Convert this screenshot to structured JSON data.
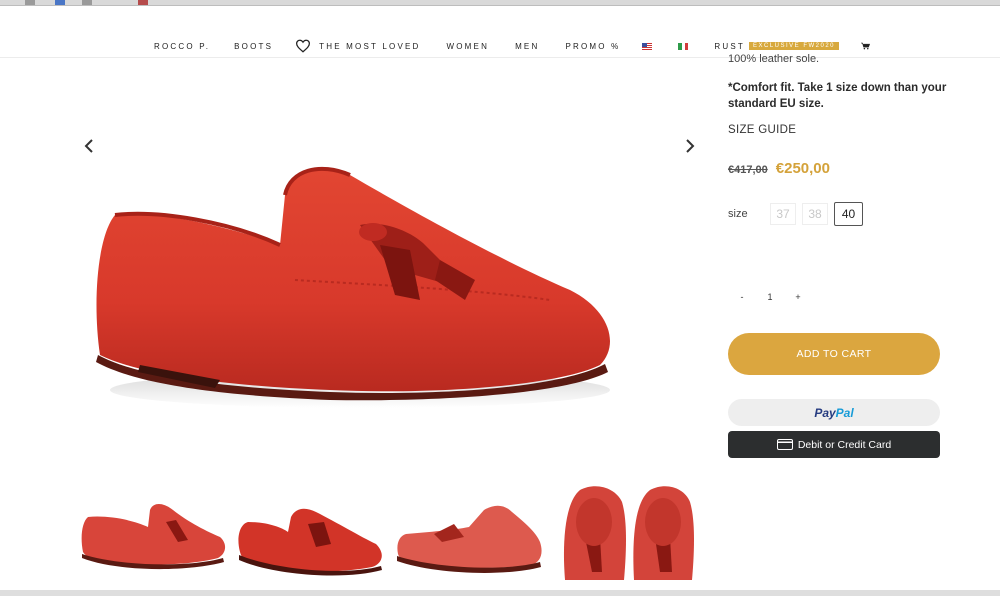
{
  "nav": {
    "items": [
      "ROCCO P.",
      "BOOTS",
      "THE MOST LOVED",
      "WOMEN",
      "MEN",
      "PROMO %"
    ],
    "rust_label": "RUST",
    "rust_badge": "EXCLUSIVE FW2020",
    "icons": [
      "heart-icon",
      "flag-us-icon",
      "flag-it-icon",
      "cart-icon"
    ]
  },
  "gallery": {
    "prev_icon": "chevron-left-icon",
    "next_icon": "chevron-right-icon",
    "main_image": "red suede tassel loafer",
    "thumbnails": [
      "red loafer side view",
      "red loafer angled view",
      "red loafer inner side view",
      "red loafers top view pair"
    ]
  },
  "product": {
    "description_partial": "100% leather sole.",
    "comfort_note": "*Comfort fit. Take 1 size down than your standard EU size.",
    "size_guide": "SIZE GUIDE",
    "price_old": "€417,00",
    "price_new": "€250,00",
    "size_label": "size",
    "sizes": [
      "37",
      "38",
      "40"
    ],
    "selected_size": "40",
    "qty_minus": "-",
    "qty_value": "1",
    "qty_plus": "+",
    "add_to_cart": "ADD TO CART",
    "paypal_pay": "Pay",
    "paypal_pal": "Pal",
    "card_button": "Debit or Credit Card"
  },
  "colors": {
    "accent_gold": "#d4a23a",
    "button_gold": "#dba63f",
    "shoe_red": "#d8392b",
    "card_button_bg": "#2c2e2f"
  }
}
